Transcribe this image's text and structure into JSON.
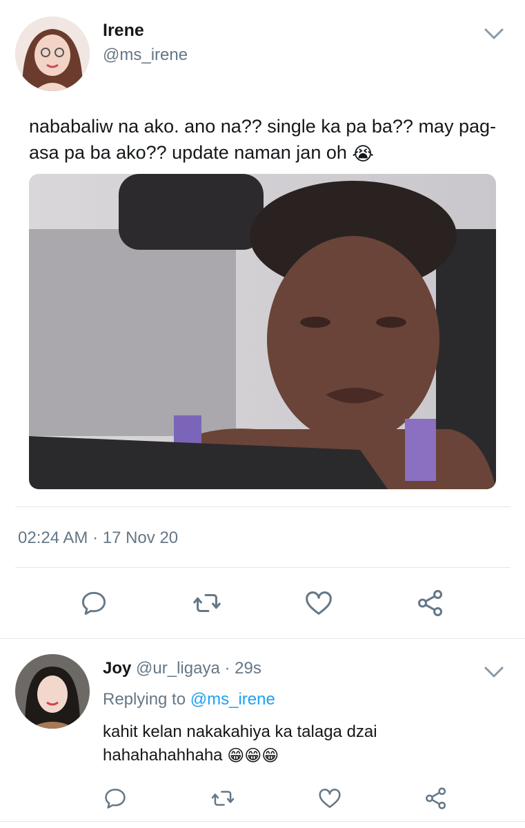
{
  "tweet": {
    "author_name": "Irene",
    "author_handle": "@ms_irene",
    "text": "nababaliw na ako. ano na?? single ka pa ba?? may pag-asa pa ba ako?? update naman jan oh",
    "text_emoji": "😭",
    "timestamp": "02:24 AM · 17 Nov 20",
    "actions": [
      "reply-icon",
      "retweet-icon",
      "like-icon",
      "share-icon"
    ]
  },
  "reply": {
    "author_name": "Joy",
    "author_handle": "@ur_ligaya",
    "time": "· 29s",
    "replying_prefix": "Replying to",
    "replying_handle": "@ms_irene",
    "text": "kahit kelan nakakahiya ka talaga dzai hahahahahhaha",
    "text_emojis": "😁😁😁",
    "actions": [
      "reply-icon",
      "retweet-icon",
      "like-icon",
      "share-icon"
    ]
  },
  "colors": {
    "link": "#1da1f2",
    "secondary_text": "#657786",
    "icon": "#657786",
    "divider": "#e1e8ed"
  }
}
